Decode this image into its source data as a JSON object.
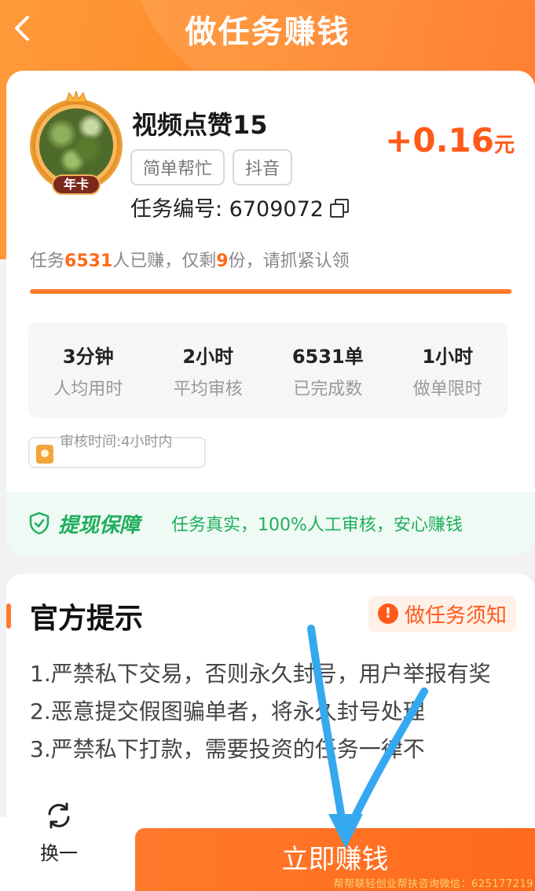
{
  "header": {
    "title": "做任务赚钱"
  },
  "task": {
    "badge": "年卡",
    "name": "视频点赞15",
    "tags": [
      "简单帮忙",
      "抖音"
    ],
    "reward_amount": "+0.16",
    "reward_unit": "元",
    "task_no_label": "任务编号: 6709072",
    "earned_prefix": "任务",
    "earned_count": "6531",
    "earned_middle": "人已赚，仅剩",
    "remaining": "9",
    "earned_suffix": "份，请抓紧认领",
    "progress_fraction": 0.999,
    "stats": [
      {
        "value": "3分钟",
        "label": "人均用时"
      },
      {
        "value": "2小时",
        "label": "平均审核"
      },
      {
        "value": "6531单",
        "label": "已完成数"
      },
      {
        "value": "1小时",
        "label": "做单限时"
      }
    ],
    "review_time": "审核时间:4小时内",
    "guarantee_title": "提现保障",
    "guarantee_text": "任务真实，100%人工审核，安心赚钱"
  },
  "tips": {
    "title": "官方提示",
    "notice_button": "做任务须知",
    "lines": [
      "1.严禁私下交易，否则永久封号，用户举报有奖",
      "2.恶意提交假图骗单者，将永久封号处理",
      "3.严禁私下打款，需要投资的任务一律不"
    ]
  },
  "bottom": {
    "switch_label": "换一",
    "earn_button": "立即赚钱",
    "watermark": "帮帮联轻创业帮扶咨询微信：625177219"
  },
  "colors": {
    "accent": "#ff6a1c",
    "green": "#1fae5c",
    "arrow": "#35a9f0"
  }
}
